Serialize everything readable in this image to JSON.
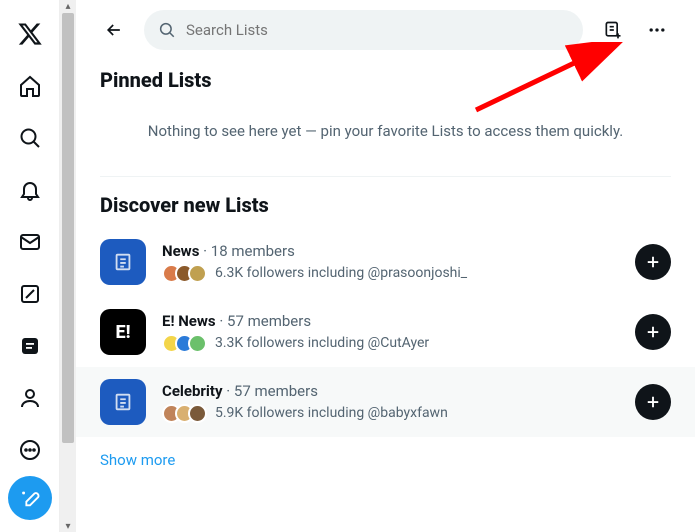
{
  "search": {
    "placeholder": "Search Lists"
  },
  "pinned": {
    "title": "Pinned Lists",
    "empty": "Nothing to see here yet — pin your favorite Lists to access them quickly."
  },
  "discover": {
    "title": "Discover new Lists",
    "items": [
      {
        "name": "News",
        "members": "18 members",
        "followers": "6.3K followers including @prasoonjoshi_"
      },
      {
        "name": "E! News",
        "members": "57 members",
        "followers": "3.3K followers including @CutAyer"
      },
      {
        "name": "Celebrity",
        "members": "57 members",
        "followers": "5.9K followers including @babyxfawn"
      }
    ],
    "show_more": "Show more"
  }
}
